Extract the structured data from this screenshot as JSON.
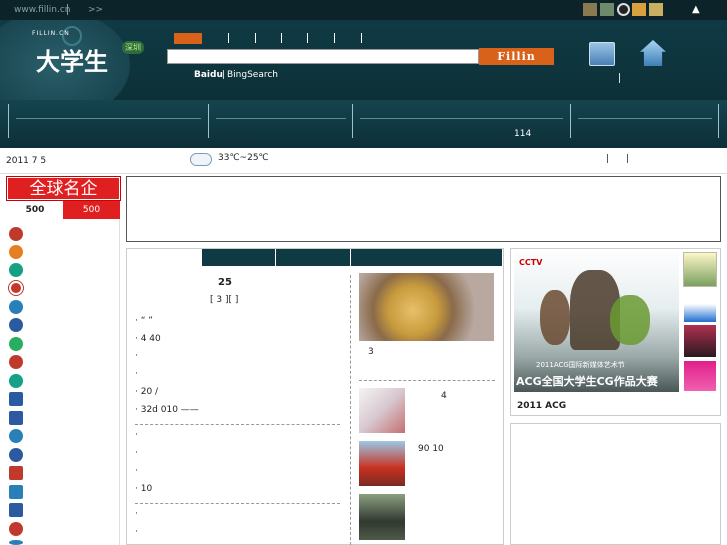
{
  "topbar": {
    "site_url": "www.fillin.cn",
    "arrow": ">>",
    "up_arrow": "▲"
  },
  "header": {
    "logo_small": "FILLIN.CN",
    "logo_main": "大学生",
    "logo_badge": "深圳",
    "search_button": "Fillin",
    "search_value": "",
    "engines_baidu": "Baidu",
    "engines_sep": "|",
    "engines_bing": "BingSearch"
  },
  "nav": {
    "count_label": "114"
  },
  "datebar": {
    "date": "2011 7 5",
    "weather": "33℃~25℃",
    "sep1": "|",
    "sep2": "|"
  },
  "sidebar": {
    "banner": "全球名企",
    "tab_left": "500",
    "tab_right": "500"
  },
  "news": {
    "headline_num": "25",
    "sub_line": "[ 3 ][ ]",
    "items": [
      {
        "text": "·        “ ”"
      },
      {
        "text": "·      4          40"
      },
      {
        "text": "·"
      },
      {
        "text": "·"
      },
      {
        "text": "·          20 /"
      },
      {
        "text": "·   32d 010      ——"
      },
      {
        "text": "·"
      },
      {
        "text": "·"
      },
      {
        "text": "·"
      },
      {
        "text": "·       10"
      },
      {
        "text": "·"
      },
      {
        "text": "·"
      }
    ],
    "photo_caption": "3",
    "side_item1": "4",
    "side_item2": "90    10"
  },
  "promo": {
    "caption": "2011 ACG",
    "poster_title": "2011ACG国际新媒体艺术节",
    "poster_sub": "ACG全国大学生CG作品大赛",
    "cctv": "CCTV"
  },
  "colors": {
    "dark_teal": "#0f3a44",
    "accent_red": "#e02020",
    "search_orange": "#d9621a"
  }
}
